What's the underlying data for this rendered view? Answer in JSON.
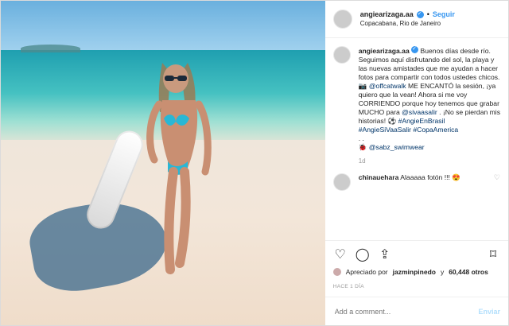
{
  "post": {
    "username": "angiearizaga.aa",
    "follow_label": "Seguir",
    "location": "Copacabana, Rio de Janeiro",
    "caption": {
      "username": "angiearizaga.aa",
      "text1": "Buenos días desde río. Seguimos aquí disfrutando del sol, la playa y las nuevas amistades que me ayudan a hacer fotos para compartir con todos ustedes chicos. ",
      "mention1": "@offcatwalk",
      "text2": "ME ENCANTÓ la sesión, ¡ya quiero que la vean! Ahora si me voy CORRIENDO porque hoy tenemos que grabar MUCHO para",
      "mention2": "@sivaasalir",
      "text3": ". ¡No se pierdan mis historias! ⚽ ",
      "hashtags1": "#AngieEnBrasil",
      "hashtags2": "#AngieSiVaaSalir #CopaAmerica",
      "dots": ". .",
      "mention3": "@sabz_swimwear",
      "age": "1d"
    },
    "comment": {
      "username": "chinauehara",
      "text": "Alaaaaa fotón !!! 😍"
    },
    "likes": {
      "prefix": "Apreciado por",
      "user": "jazminpinedo",
      "conj": "y",
      "count": "60,448 otros"
    },
    "time_ago": "HACE 1 DÍA",
    "add_comment_placeholder": "Add a comment...",
    "post_button": "Enviar"
  }
}
